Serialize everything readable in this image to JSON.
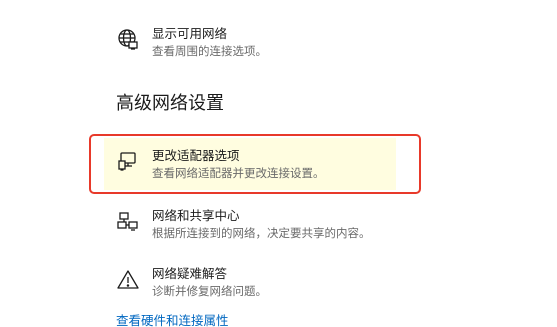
{
  "items": [
    {
      "icon": "globe-network-icon",
      "title": "显示可用网络",
      "desc": "查看周围的连接选项。"
    },
    {
      "icon": "monitor-adapter-icon",
      "title": "更改适配器选项",
      "desc": "查看网络适配器并更改连接设置。"
    },
    {
      "icon": "network-sharing-icon",
      "title": "网络和共享中心",
      "desc": "根据所连接到的网络，决定要共享的内容。"
    },
    {
      "icon": "warning-triangle-icon",
      "title": "网络疑难解答",
      "desc": "诊断并修复网络问题。"
    }
  ],
  "section": {
    "title": "高级网络设置"
  },
  "link": {
    "label": "查看硬件和连接属性"
  },
  "colors": {
    "highlight_border": "#e8392a",
    "highlight_bg": "#fffde0",
    "link": "#0067c0"
  }
}
